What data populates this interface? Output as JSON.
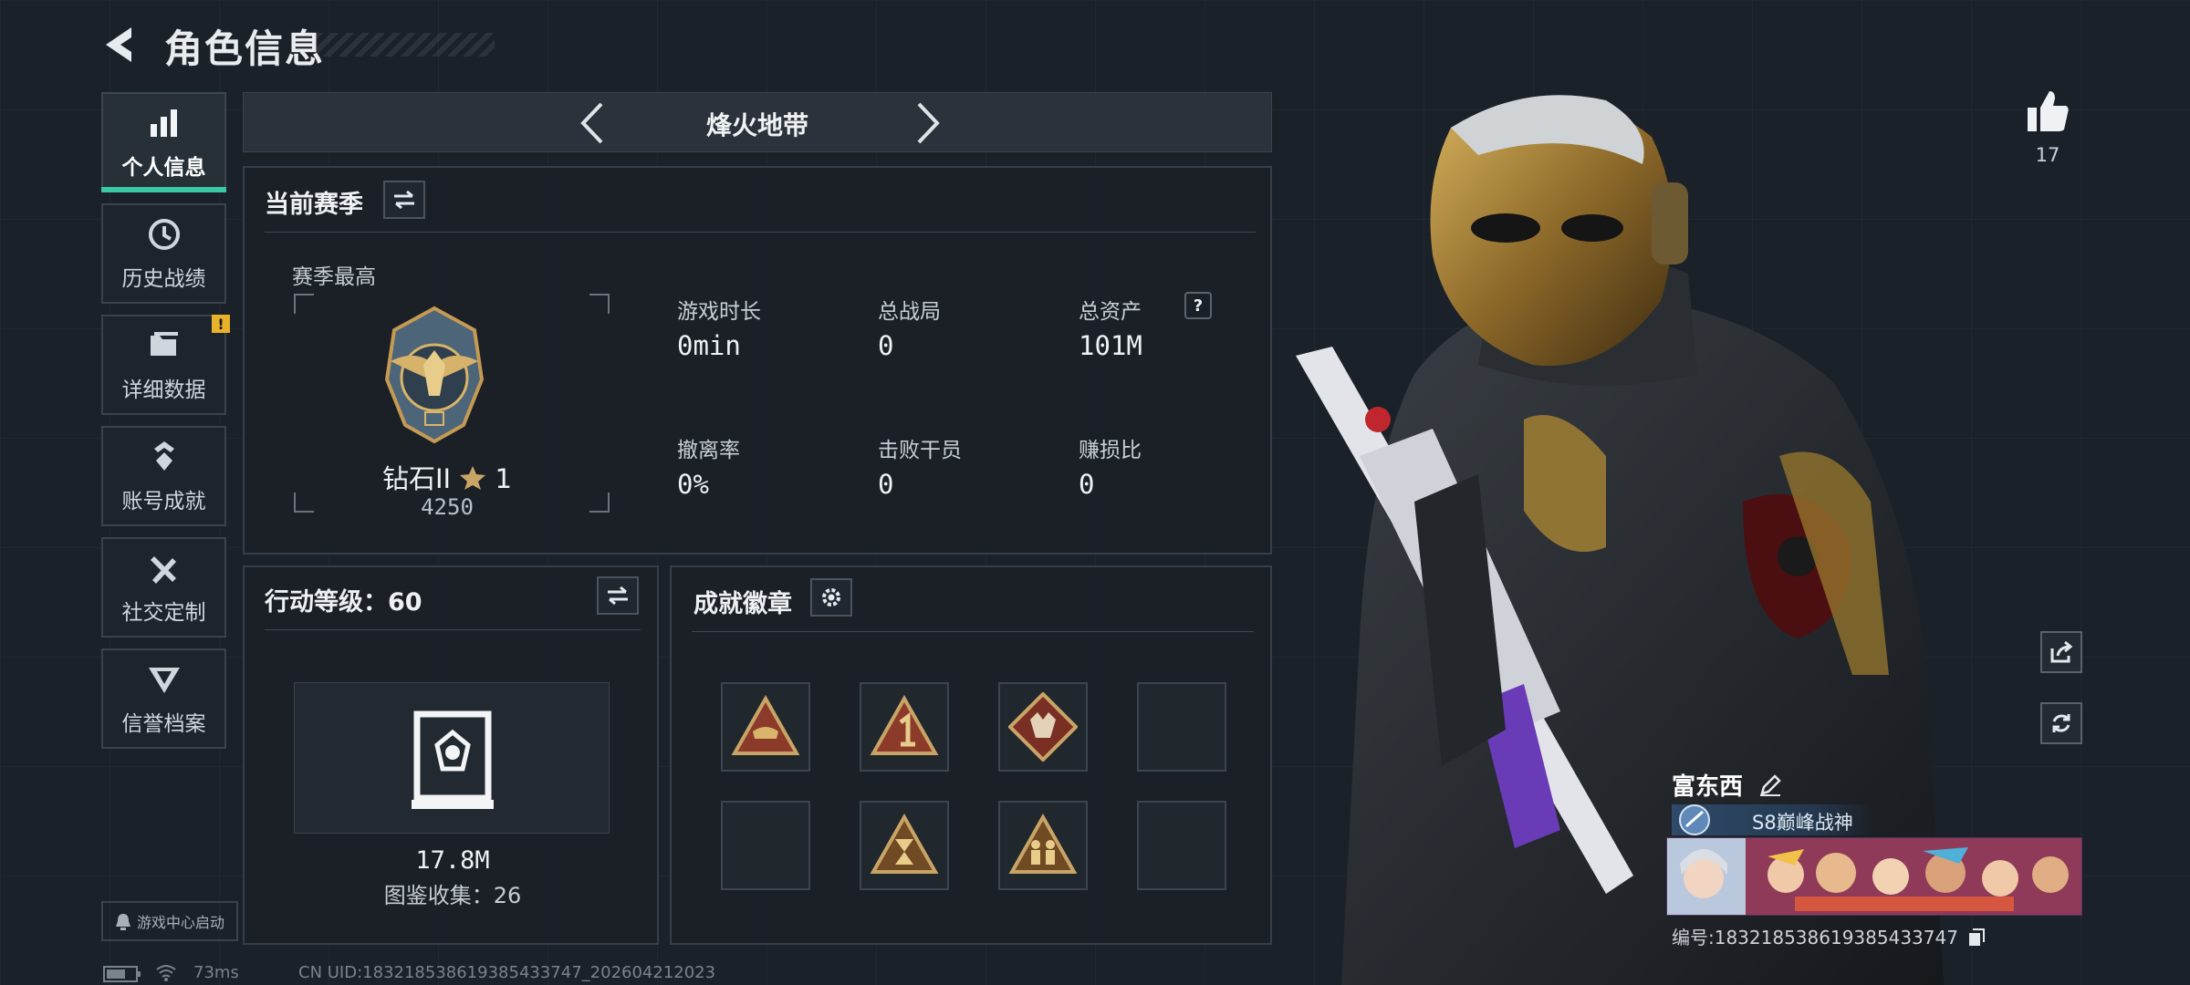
{
  "header": {
    "title": "角色信息"
  },
  "sidebar": {
    "items": [
      {
        "label": "个人信息",
        "icon": "bar-chart-icon",
        "active": true
      },
      {
        "label": "历史战绩",
        "icon": "clock-history-icon",
        "active": false
      },
      {
        "label": "详细数据",
        "icon": "folder-icon",
        "active": false,
        "badge": "!"
      },
      {
        "label": "账号成就",
        "icon": "achievement-icon",
        "active": false
      },
      {
        "label": "社交定制",
        "icon": "tools-icon",
        "active": false
      },
      {
        "label": "信誉档案",
        "icon": "shield-rank-icon",
        "active": false
      }
    ],
    "game_center": "游戏中心启动"
  },
  "mode": {
    "title": "烽火地带"
  },
  "season": {
    "title": "当前赛季",
    "best_label": "赛季最高",
    "rank_name": "钻石II",
    "rank_stars": "1",
    "rank_points": "4250",
    "stats": [
      {
        "label": "游戏时长",
        "value": "0min"
      },
      {
        "label": "总战局",
        "value": "0"
      },
      {
        "label": "总资产",
        "value": "101M",
        "help": "?"
      },
      {
        "label": "撤离率",
        "value": "0%"
      },
      {
        "label": "击败干员",
        "value": "0"
      },
      {
        "label": "赚损比",
        "value": "0"
      }
    ]
  },
  "action_level": {
    "title": "行动等级：60",
    "value": "17.8M",
    "collection": "图鉴收集：26"
  },
  "achievements": {
    "title": "成就徽章",
    "slots": [
      {
        "icon": "boot-triangle-badge-icon",
        "filled": true
      },
      {
        "icon": "number-one-triangle-badge-icon",
        "filled": true
      },
      {
        "icon": "wolf-diamond-badge-icon",
        "filled": true
      },
      {
        "icon": "empty-slot",
        "filled": false
      },
      {
        "icon": "empty-slot",
        "filled": false
      },
      {
        "icon": "hourglass-triangle-badge-icon",
        "filled": true
      },
      {
        "icon": "soldiers-triangle-badge-icon",
        "filled": true
      },
      {
        "icon": "empty-slot",
        "filled": false
      }
    ]
  },
  "profile": {
    "likes": "17",
    "name": "富东西",
    "title": "S8巅峰战神",
    "id_line": "编号:183218538619385433747"
  },
  "footer": {
    "ping": "73ms",
    "uid": "CN UID:183218538619385433747_202604212023"
  },
  "colors": {
    "accent": "#39c7a4",
    "badge_gold": "#c9a467",
    "alert": "#e9b22c"
  }
}
